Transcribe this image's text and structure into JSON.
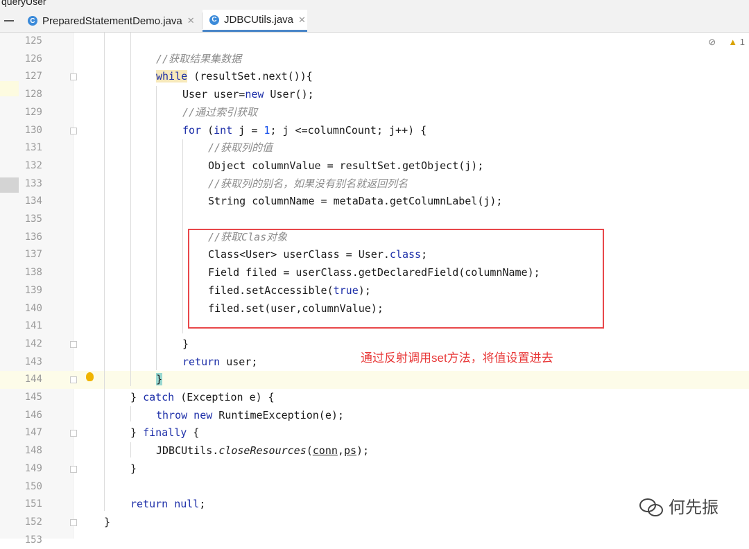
{
  "window": {
    "breadcrumb": "queryUser"
  },
  "tabs": [
    {
      "label": "PreparedStatementDemo.java",
      "icon": "java-class-icon"
    },
    {
      "label": "JDBCUtils.java",
      "icon": "java-class-icon",
      "active": true
    }
  ],
  "inspection": {
    "hidden_icon": "eye-off-icon",
    "warning_icon": "warning-triangle-icon",
    "warning_count": "1"
  },
  "editor": {
    "line_numbers": [
      "125",
      "126",
      "127",
      "128",
      "129",
      "130",
      "131",
      "132",
      "133",
      "134",
      "135",
      "136",
      "137",
      "138",
      "139",
      "140",
      "141",
      "142",
      "143",
      "144",
      "145",
      "146",
      "147",
      "148",
      "149",
      "150",
      "151",
      "152",
      "153"
    ],
    "current_line": "144"
  },
  "annotation": {
    "text": "通过反射调用set方法，将值设置进去",
    "box_color": "#e8474a",
    "text_color": "#e83838"
  },
  "watermark": {
    "text": "何先振",
    "icon": "wechat-icon"
  },
  "colors": {
    "keyword": "#1c2ea8",
    "comment": "#8c8c8c",
    "number": "#1750eb",
    "tab_accent": "#4a86c7"
  }
}
